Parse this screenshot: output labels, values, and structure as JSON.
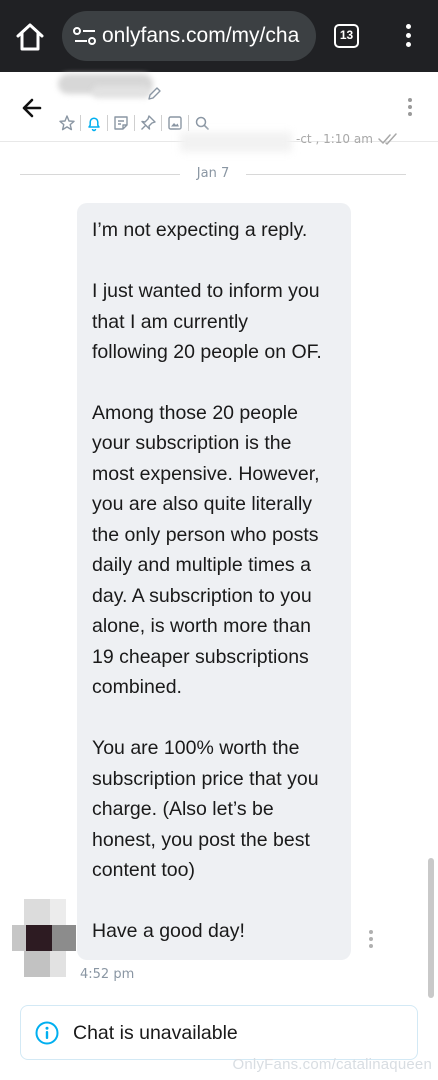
{
  "browser": {
    "url": "onlyfans.com/my/cha",
    "tab_count": "13"
  },
  "chat": {
    "prev_receipt_fragment": "-ct , 1:10 am",
    "date_separator": "Jan 7",
    "message_lines": [
      "I’m not expecting a reply.",
      "",
      "I just wanted to inform you",
      "that I am currently",
      "following 20 people on OF.",
      "",
      "Among those 20 people",
      "your subscription is the",
      "most expensive. However,",
      "you are also quite literally",
      "the only person who posts",
      "daily and multiple times a",
      "day. A subscription to you",
      "alone, is worth more than",
      "19 cheaper subscriptions",
      "combined.",
      "",
      "You are 100% worth the",
      "subscription price that you",
      "charge. (Also let’s be",
      "honest, you post the best",
      "content too)",
      "",
      "Have a good day!"
    ],
    "time": "4:52 pm"
  },
  "notice": {
    "text": "Chat is unavailable"
  },
  "watermark": "OnlyFans.com/catalinaqueen",
  "colors": {
    "browser_bar": "#202124",
    "url_pill": "#3c4043",
    "bubble": "#eef0f3",
    "accent_blue": "#00aff0",
    "muted_text": "#8a96a3"
  },
  "icons": [
    "home-icon",
    "site-settings-icon",
    "tab-switcher-icon",
    "browser-menu-icon",
    "back-arrow-icon",
    "edit-pencil-icon",
    "star-icon",
    "bell-icon",
    "note-icon",
    "pin-icon",
    "image-icon",
    "search-icon",
    "more-vert-icon",
    "double-check-icon",
    "info-icon"
  ]
}
